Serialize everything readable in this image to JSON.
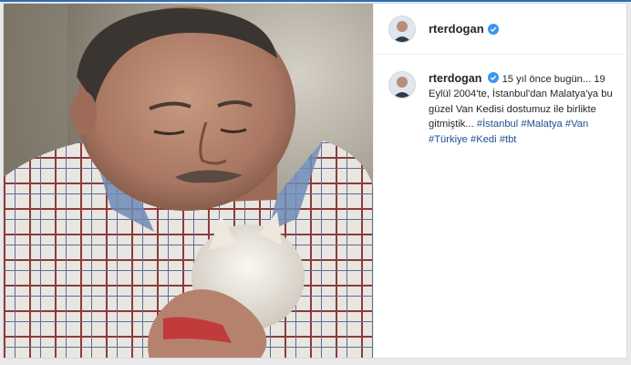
{
  "post": {
    "username": "rterdogan",
    "caption_segments": [
      "15 yıl önce bugün... 19 Eylül 2004'te, İstanbul'dan Malatya'ya bu güzel Van Kedisi dostumuz ile birlikte gitmiştik...",
      "#İstanbul",
      "#Malatya",
      "#Van",
      "#Türkiye",
      "#Kedi",
      "#tbt"
    ]
  },
  "colors": {
    "accent_line": "#2d6db6",
    "hashtag": "#1f4f8f",
    "verified_badge": "#3897f0"
  },
  "icons": {
    "verified": "verified-badge-icon"
  }
}
